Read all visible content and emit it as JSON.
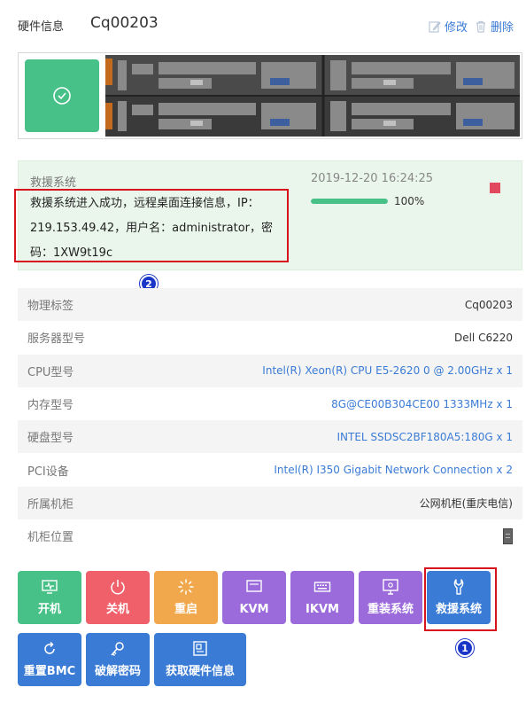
{
  "header": {
    "label": "硬件信息",
    "asset_id": "Cq00203",
    "edit_label": "修改",
    "delete_label": "删除"
  },
  "status": {
    "icon": "check-circle-icon",
    "color": "#48c188"
  },
  "rescue": {
    "title": "救援系统",
    "message": "救援系统进入成功，远程桌面连接信息，IP：219.153.49.42，用户名：administrator，密码：1XW9t19c",
    "timestamp": "2019-12-20 16:24:25",
    "progress": 100,
    "progress_text": "100%"
  },
  "info": [
    {
      "label": "物理标签",
      "value": "Cq00203"
    },
    {
      "label": "服务器型号",
      "value": "Dell C6220"
    },
    {
      "label": "CPU型号",
      "value": "Intel(R) Xeon(R) CPU E5-2620 0 @ 2.00GHz x 1"
    },
    {
      "label": "内存型号",
      "value": "8G@CE00B304CE00 1333MHz x 1"
    },
    {
      "label": "硬盘型号",
      "value": "INTEL SSDSC2BF180A5:180G x 1"
    },
    {
      "label": "PCI设备",
      "value": "Intel(R) I350 Gigabit Network Connection x 2"
    },
    {
      "label": "所属机柜",
      "value": "公网机柜(重庆电信)"
    },
    {
      "label": "机柜位置",
      "value": ""
    }
  ],
  "buttons": {
    "power_on": "开机",
    "power_off": "关机",
    "restart": "重启",
    "kvm": "KVM",
    "ikvm": "IKVM",
    "reinstall": "重装系统",
    "rescue": "救援系统",
    "reset_bmc": "重置BMC",
    "crack_password": "破解密码",
    "fetch_hardware": "获取硬件信息"
  },
  "annotations": {
    "badge1": "1",
    "badge2": "2"
  },
  "colors": {
    "green": "#48c188",
    "red": "#f0606a",
    "orange": "#f1a84c",
    "purple": "#9b6bdc",
    "blue": "#3a7bd5",
    "highlight": "#d7141e"
  }
}
